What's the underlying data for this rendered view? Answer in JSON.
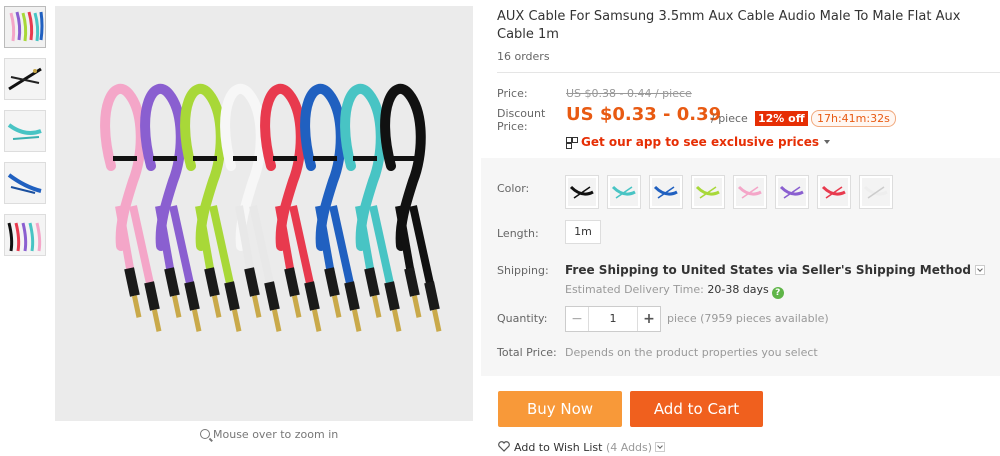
{
  "product": {
    "title": "AUX Cable For Samsung 3.5mm Aux Cable Audio Male To Male Flat Aux Cable 1m",
    "orders": "16 orders"
  },
  "gallery": {
    "thumbnail_icons": [
      "black-cable-thumb",
      "teal-cable-thumb",
      "blue-cable-thumb",
      "multicolor-cable-thumb"
    ],
    "zoom_hint": "Mouse over to zoom in",
    "cable_colors": [
      "#f4a6c8",
      "#8a5fd0",
      "#a8d838",
      "#f5f5f5",
      "#e83a4e",
      "#2060c0",
      "#48c4c4",
      "#111111"
    ]
  },
  "price": {
    "label": "Price:",
    "original": "US $0.38 - 0.44 / piece",
    "discount_label": "Discount Price:",
    "discount": "US $0.33 - 0.39",
    "per_piece": "/ piece",
    "off_badge": "12% off",
    "timer": "17h:41m:32s",
    "app_promo": "Get our app to see exclusive prices",
    "accent_color": "#e85a12"
  },
  "options": {
    "color_label": "Color:",
    "colors": [
      {
        "name": "black",
        "hex": "#111111"
      },
      {
        "name": "teal",
        "hex": "#48c4c4"
      },
      {
        "name": "blue",
        "hex": "#2060c0"
      },
      {
        "name": "green",
        "hex": "#a8d838"
      },
      {
        "name": "pink",
        "hex": "#f4a6c8"
      },
      {
        "name": "purple",
        "hex": "#8a5fd0"
      },
      {
        "name": "red",
        "hex": "#e83a4e"
      },
      {
        "name": "white",
        "hex": "#eeeeee"
      }
    ],
    "length_label": "Length:",
    "length_value": "1m",
    "shipping_label": "Shipping:",
    "shipping_text": "Free Shipping to United States via Seller's Shipping Method",
    "delivery_label": "Estimated Delivery Time:",
    "delivery_value": "20-38 days",
    "quantity_label": "Quantity:",
    "quantity_value": "1",
    "quantity_note": "piece (7959 pieces available)",
    "total_label": "Total Price:",
    "total_text": "Depends on the product properties you select"
  },
  "actions": {
    "buy_now": "Buy Now",
    "add_to_cart": "Add to Cart",
    "wish_list": "Add to Wish List",
    "wish_count": "(4 Adds)"
  }
}
